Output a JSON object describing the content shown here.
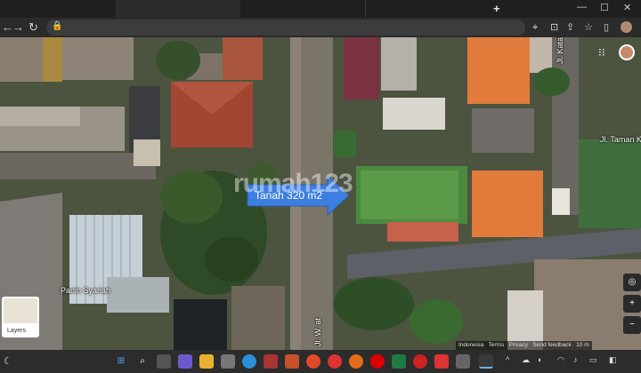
{
  "browser": {
    "new_tab_symbol": "+",
    "window_controls": [
      "—",
      "☐",
      "✕"
    ],
    "nav_icons": [
      "arrow-left-icon",
      "arrow-right-icon",
      "reload-icon",
      "home-icon"
    ],
    "toolbar_icons": [
      "location-icon",
      "install-icon",
      "share-icon",
      "zoom-icon",
      "bookmark-star-icon",
      "sidepanel-icon",
      "extension-icon"
    ]
  },
  "map": {
    "annotation_label": "Tanah 320 m2",
    "watermark": "rumah123",
    "street_labels": [
      {
        "text": "Jl. Katalia II"
      },
      {
        "text": "Jl. Taman K"
      },
      {
        "text": "Jl. W. at"
      }
    ],
    "place_labels": [
      {
        "text": "Panin Syariah"
      }
    ],
    "layers_label": "Layers",
    "attribution": [
      "Indonesia",
      "Terms",
      "Privacy",
      "Send feedback"
    ],
    "scale_label": "10 m",
    "arrow_color": "#3d7fe0"
  },
  "taskbar": {
    "apps": [
      "windows-icon",
      "search-icon",
      "taskview-icon",
      "chat-icon",
      "explorer-icon",
      "settings-icon",
      "edge-icon",
      "access-icon",
      "powerpoint-icon",
      "chrome-icon",
      "firefox-icon",
      "opera-icon",
      "excel-icon",
      "pdf-icon",
      "screenrec-icon",
      "acrobat-icon",
      "notepad-icon",
      "chrome-active-icon"
    ],
    "tray_symbol": "^"
  }
}
